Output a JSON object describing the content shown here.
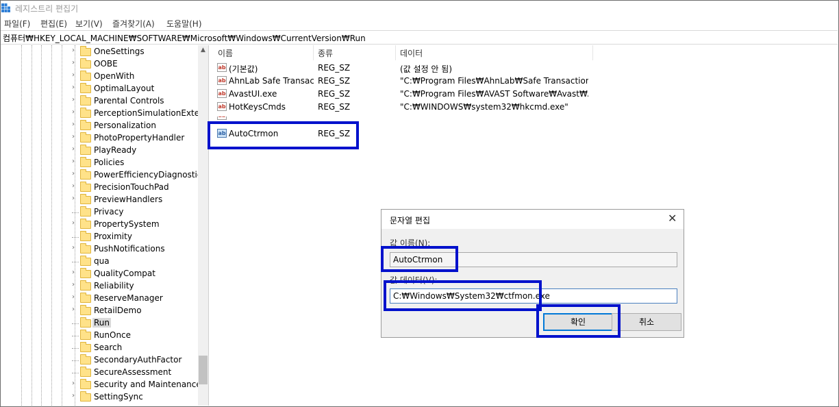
{
  "window": {
    "title": "레지스트리 편집기"
  },
  "menu": [
    "파일(F)",
    "편집(E)",
    "보기(V)",
    "즐겨찾기(A)",
    "도움말(H)"
  ],
  "address": "컴퓨터₩HKEY_LOCAL_MACHINE₩SOFTWARE₩Microsoft₩Windows₩CurrentVersion₩Run",
  "tree": {
    "items": [
      "OneSettings",
      "OOBE",
      "OpenWith",
      "OptimalLayout",
      "Parental Controls",
      "PerceptionSimulationExtens",
      "Personalization",
      "PhotoPropertyHandler",
      "PlayReady",
      "Policies",
      "PowerEfficiencyDiagnostics",
      "PrecisionTouchPad",
      "PreviewHandlers",
      "Privacy",
      "PropertySystem",
      "Proximity",
      "PushNotifications",
      "qua",
      "QualityCompat",
      "Reliability",
      "ReserveManager",
      "RetailDemo",
      "Run",
      "RunOnce",
      "Search",
      "SecondaryAuthFactor",
      "SecureAssessment",
      "Security and Maintenance",
      "SettingSync"
    ],
    "selected": "Run"
  },
  "list": {
    "headers": {
      "name": "이름",
      "type": "종류",
      "data": "데이터"
    },
    "rows": [
      {
        "name": "(기본값)",
        "type": "REG_SZ",
        "data": "(값 설정 안 됨)"
      },
      {
        "name": "AhnLab Safe Transac...",
        "type": "REG_SZ",
        "data": "\"C:₩Program Files₩AhnLab₩Safe Transaction₩st..."
      },
      {
        "name": "AvastUI.exe",
        "type": "REG_SZ",
        "data": "\"C:₩Program Files₩AVAST Software₩Avast₩AvL..."
      },
      {
        "name": "HotKeysCmds",
        "type": "REG_SZ",
        "data": "\"C:₩WINDOWS₩system32₩hkcmd.exe\""
      }
    ],
    "new_row": {
      "name": "AutoCtrmon",
      "type": "REG_SZ"
    }
  },
  "dialog": {
    "title": "문자열 편집",
    "value_name_label": "값 이름(N):",
    "value_name": "AutoCtrmon",
    "value_data_label": "값 데이터(V):",
    "value_data": "C:₩Windows₩System32₩ctfmon.exe",
    "ok": "확인",
    "cancel": "취소"
  },
  "colors": {
    "highlight": "#0011cc",
    "folder": "#ffe289",
    "button_focus": "#0078d7"
  }
}
